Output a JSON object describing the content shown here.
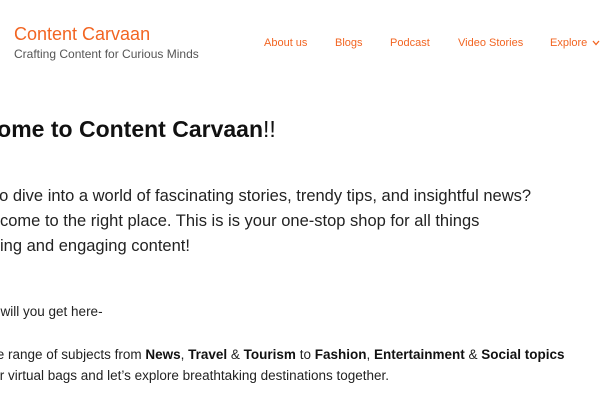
{
  "header": {
    "site_title": "Content Carvaan",
    "tagline": "Crafting Content for Curious Minds",
    "accent_color": "#f26522"
  },
  "nav": {
    "items": [
      {
        "label": "About us"
      },
      {
        "label": "Blogs"
      },
      {
        "label": "Podcast"
      },
      {
        "label": "Video Stories"
      },
      {
        "label": "Explore",
        "icon": "chevron-down-icon"
      }
    ]
  },
  "main": {
    "heading_text": "lcome to Content Carvaan",
    "heading_bang": "!!",
    "intro_lines": [
      "ly to dive into a world of fascinating stories, trendy tips, and insightful news?",
      "ve come to the right place. This is is your one-stop shop for all things",
      "esting and engaging content!"
    ],
    "subhead": "hat will you get here-",
    "subjects": {
      "prefix": "erse range of subjects from ",
      "news": "News",
      "sep1": ", ",
      "travel": "Travel",
      "amp1": " & ",
      "tourism": "Tourism",
      "to": " to ",
      "fashion": "Fashion",
      "sep2": ", ",
      "entertainment": "Entertainment",
      "amp2": " & ",
      "social": "Social topics",
      "line2": "your virtual bags and let’s explore breathtaking destinations together."
    }
  }
}
